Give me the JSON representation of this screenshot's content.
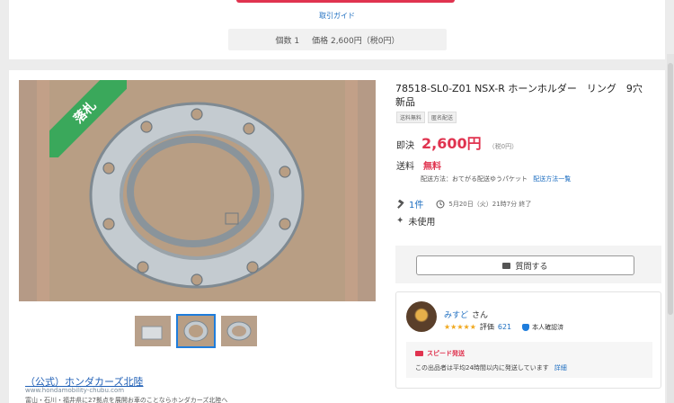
{
  "top": {
    "guide_link": "取引ガイド",
    "quantity": "個数 1",
    "price_summary": "価格 2,600円（税0円）"
  },
  "gallery": {
    "ribbon": "落札",
    "thumbnail_count": 3,
    "active_thumbnail": 2
  },
  "item": {
    "title": "78518-SL0-Z01 NSX-R ホーンホルダー　リング　9穴　新品",
    "tags": [
      "送料無料",
      "匿名配送"
    ],
    "price_label": "即決",
    "price": "2,600円",
    "tax": "（税0円）",
    "shipping_label": "送料",
    "shipping_value": "無料",
    "shipping_method": "配送方法：おてがる配送ゆうパケット",
    "shipping_link": "配送方法一覧",
    "bids": "1件",
    "end_time": "5月20日（火）21時7分 終了",
    "condition": "未使用"
  },
  "ask": {
    "button": "質問する"
  },
  "seller": {
    "name": "みすど",
    "honorific": "さん",
    "stars": "★★★★★",
    "rating_label": "評価",
    "rating": "621",
    "verified": "本人確認済",
    "speed_title": "スピード発送",
    "speed_desc": "この出品者は平均24時間以内に発送しています",
    "speed_link": "詳細"
  },
  "ad": {
    "title": "（公式）ホンダカーズ北陸",
    "url": "www.hondamobility-chubu.com",
    "desc": "富山・石川・福井県に27拠点を展開お車のことならホンダカーズ北陸へ"
  },
  "colors": {
    "accent_red": "#e0334f",
    "link_blue": "#1f6fc1",
    "ribbon_green": "#3aa85b"
  }
}
